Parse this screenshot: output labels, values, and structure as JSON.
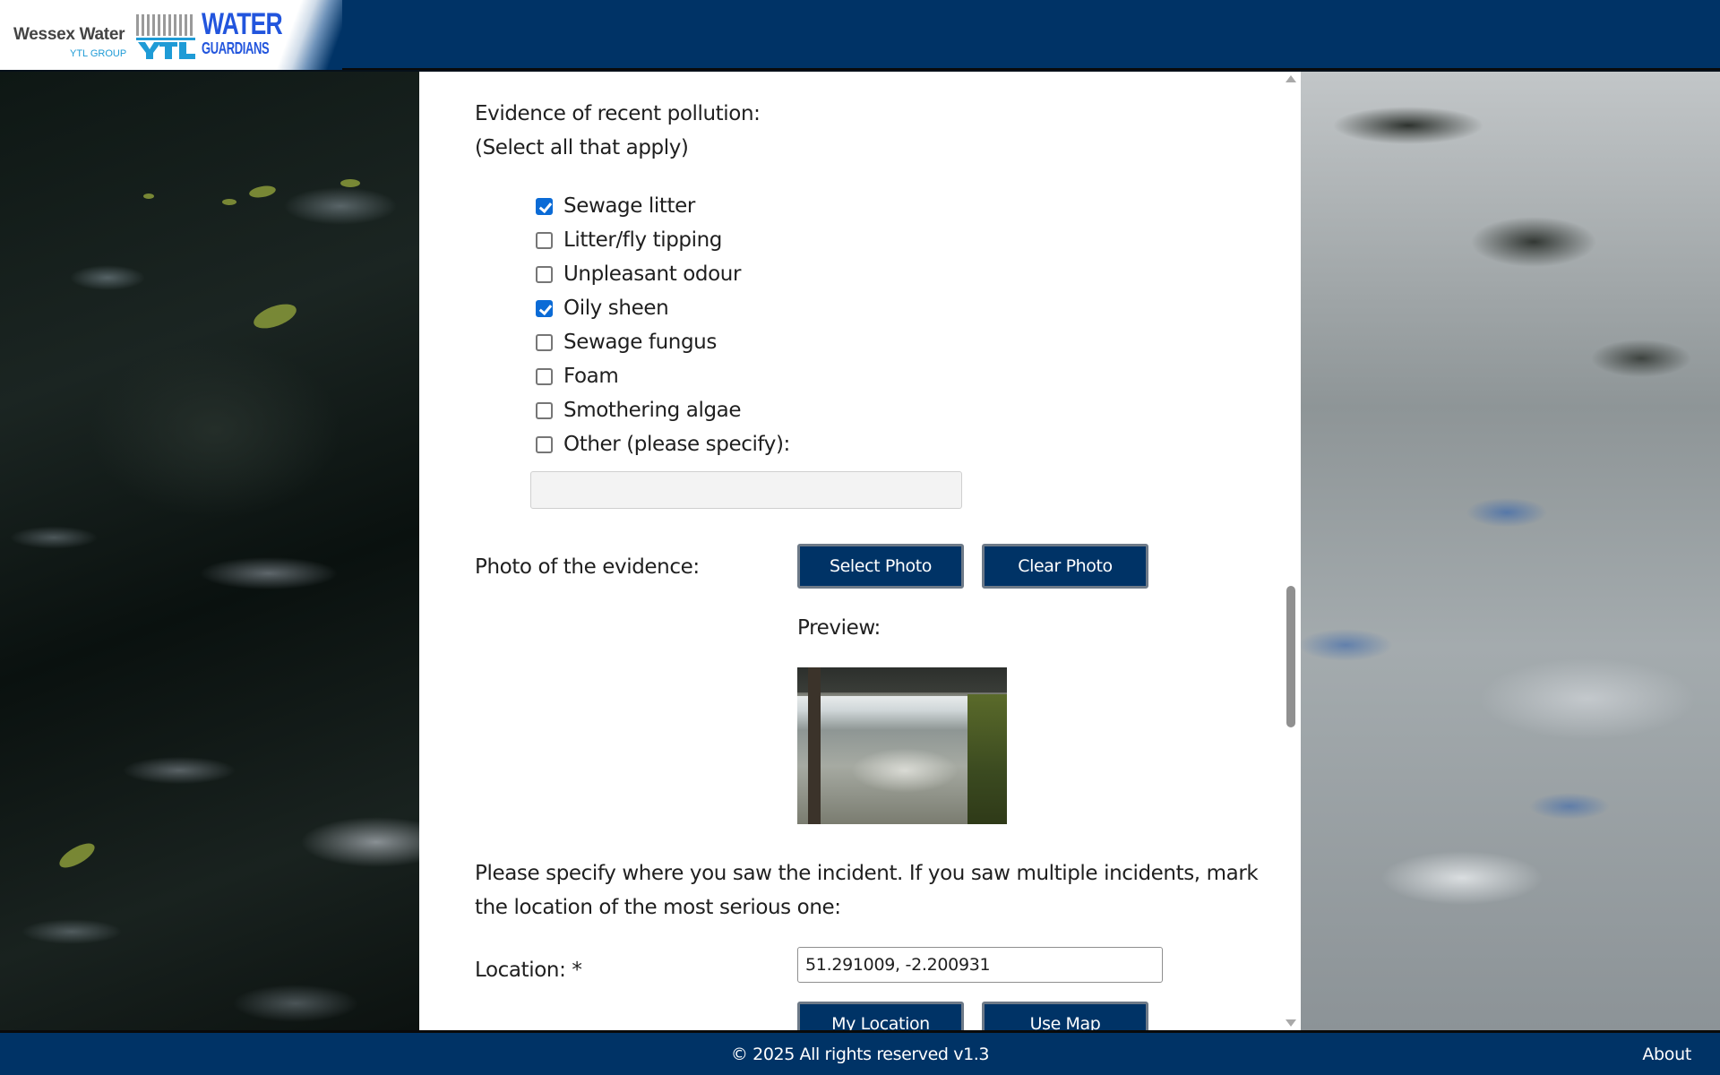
{
  "header": {
    "brand_name": "Wessex Water",
    "brand_group": "YTL GROUP",
    "app_logo_line1": "WATER",
    "app_logo_line2": "GUARDIANS",
    "colors": {
      "header_bg": "#003366",
      "accent": "#0b6bd6"
    }
  },
  "form": {
    "pollution_heading": "Evidence of recent pollution:",
    "pollution_subheading": "(Select all that apply)",
    "pollution_options": [
      {
        "label": "Sewage litter",
        "checked": true
      },
      {
        "label": "Litter/fly tipping",
        "checked": false
      },
      {
        "label": "Unpleasant odour",
        "checked": false
      },
      {
        "label": "Oily sheen",
        "checked": true
      },
      {
        "label": "Sewage fungus",
        "checked": false
      },
      {
        "label": "Foam",
        "checked": false
      },
      {
        "label": "Smothering algae",
        "checked": false
      },
      {
        "label": "Other (please specify):",
        "checked": false
      }
    ],
    "other_value": "",
    "photo_label": "Photo of the evidence:",
    "select_photo_label": "Select Photo",
    "clear_photo_label": "Clear Photo",
    "preview_label": "Preview:",
    "location_instructions_line1": "Please specify where you saw the incident. If you saw multiple incidents, mark",
    "location_instructions_line2": "the location of the most serious one:",
    "location_label": "Location: *",
    "location_value": "51.291009, -2.200931",
    "my_location_label": "My Location",
    "use_map_label": "Use Map"
  },
  "footer": {
    "copyright": "© 2025 All rights reserved v1.3",
    "about_label": "About"
  }
}
